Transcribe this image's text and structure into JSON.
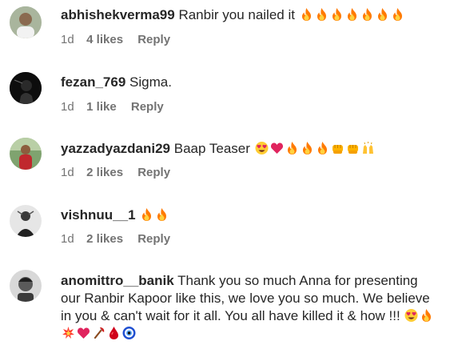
{
  "comments": [
    {
      "username": "abhishekverma99",
      "text": "Ranbir you nailed it",
      "emojis": [
        "fire",
        "fire",
        "fire",
        "fire",
        "fire",
        "fire",
        "fire"
      ],
      "time": "1d",
      "likes": "4 likes",
      "reply": "Reply"
    },
    {
      "username": "fezan_769",
      "text": "Sigma.",
      "emojis": [],
      "time": "1d",
      "likes": "1 like",
      "reply": "Reply"
    },
    {
      "username": "yazzadyazdani29",
      "text": "Baap Teaser",
      "emojis": [
        "heart-eyes",
        "red-heart",
        "fire",
        "fire",
        "fire",
        "fist",
        "fist",
        "raised-hands"
      ],
      "time": "1d",
      "likes": "2 likes",
      "reply": "Reply"
    },
    {
      "username": "vishnuu__1",
      "text": "",
      "emojis": [
        "fire",
        "fire"
      ],
      "time": "1d",
      "likes": "2 likes",
      "reply": "Reply"
    },
    {
      "username": "anomittro__banik",
      "text": "Thank you so much Anna for presenting our Ranbir Kapoor like this, we love you so much. We believe in you & can't wait for it all. You all have killed it & how !!!",
      "emojis": [
        "heart-eyes",
        "fire",
        "collision",
        "red-heart",
        "axe",
        "drop-of-blood",
        "nazar-amulet"
      ],
      "time": "",
      "likes": "",
      "reply": ""
    }
  ],
  "colors": {
    "text": "#262626",
    "meta": "#737373",
    "fire": "#ff7a00",
    "heart": "#e0245e"
  }
}
